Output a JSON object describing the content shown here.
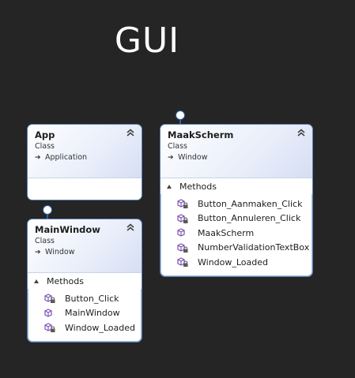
{
  "diagram": {
    "title": "GUI",
    "classes": [
      {
        "name": "App",
        "kind": "Class",
        "base": "Application",
        "sections": []
      },
      {
        "name": "MainWindow",
        "kind": "Class",
        "base": "Window",
        "sections": [
          {
            "label": "Methods",
            "members": [
              {
                "name": "Button_Click",
                "access": "private"
              },
              {
                "name": "MainWindow",
                "access": "public"
              },
              {
                "name": "Window_Loaded",
                "access": "private"
              }
            ]
          }
        ]
      },
      {
        "name": "MaakScherm",
        "kind": "Class",
        "base": "Window",
        "sections": [
          {
            "label": "Methods",
            "members": [
              {
                "name": "Button_Aanmaken_Click",
                "access": "private"
              },
              {
                "name": "Button_Annuleren_Click",
                "access": "private"
              },
              {
                "name": "MaakScherm",
                "access": "public"
              },
              {
                "name": "NumberValidationTextBox",
                "access": "private"
              },
              {
                "name": "Window_Loaded",
                "access": "private"
              }
            ]
          }
        ]
      }
    ]
  },
  "colors": {
    "background": "#252526",
    "border": "#5b7fb3",
    "method_icon": "#7b4fb3",
    "lock": "#5a5a5a",
    "interface_lollipop": "#2d5ea9"
  }
}
